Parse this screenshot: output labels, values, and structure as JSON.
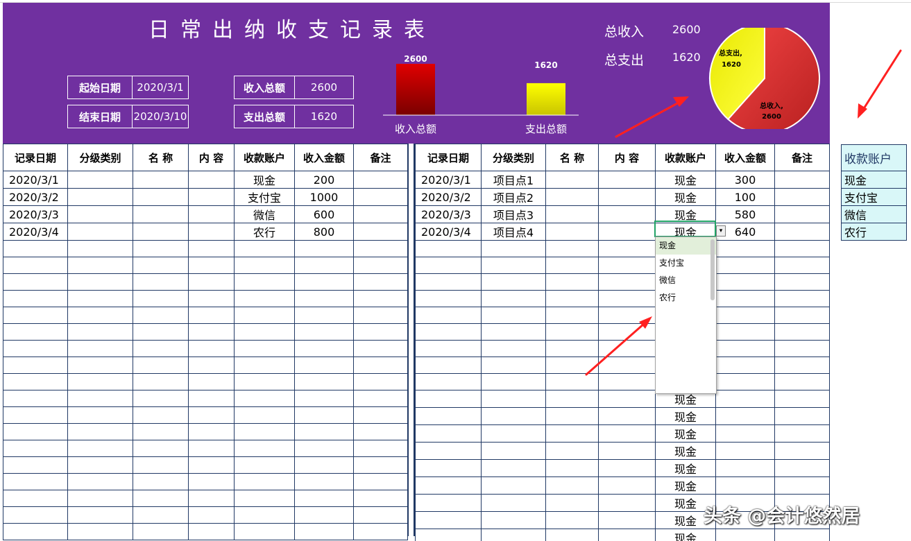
{
  "title": "日常出纳收支记录表",
  "kpis": [
    {
      "label": "起始日期",
      "value": "2020/3/1"
    },
    {
      "label": "结束日期",
      "value": "2020/3/10"
    },
    {
      "label": "收入总额",
      "value": "2600"
    },
    {
      "label": "支出总额",
      "value": "1620"
    }
  ],
  "summary": {
    "income_label": "总收入",
    "income_value": "2600",
    "expense_label": "总支出",
    "expense_value": "1620"
  },
  "colors": {
    "purple": "#7030a0",
    "income_bar": "#c00000",
    "expense_bar": "#f2e600",
    "pie_income": "#e03a3a",
    "pie_expense": "#e6e600",
    "account_fill": "#d9f7f8",
    "active_cell": "#21a366"
  },
  "chart_data": [
    {
      "type": "bar",
      "categories": [
        "收入总额",
        "支出总额"
      ],
      "values": [
        2600,
        1620
      ],
      "title": ""
    },
    {
      "type": "pie",
      "labels": [
        "总收入",
        "总支出"
      ],
      "values": [
        2600,
        1620
      ],
      "data_labels": [
        "总收入,",
        "总支出,"
      ],
      "title": ""
    }
  ],
  "income_table": {
    "headers": [
      "记录日期",
      "分级类别",
      "名 称",
      "内 容",
      "收款账户",
      "收入金额",
      "备注"
    ],
    "rows": [
      [
        "2020/3/1",
        "",
        "",
        "",
        "现金",
        "200",
        ""
      ],
      [
        "2020/3/2",
        "",
        "",
        "",
        "支付宝",
        "1000",
        ""
      ],
      [
        "2020/3/3",
        "",
        "",
        "",
        "微信",
        "600",
        ""
      ],
      [
        "2020/3/4",
        "",
        "",
        "",
        "农行",
        "800",
        ""
      ]
    ]
  },
  "expense_table": {
    "headers": [
      "记录日期",
      "分级类别",
      "名 称",
      "内 容",
      "收款账户",
      "收入金额",
      "备注"
    ],
    "rows": [
      [
        "2020/3/1",
        "项目点1",
        "",
        "",
        "现金",
        "300",
        ""
      ],
      [
        "2020/3/2",
        "项目点2",
        "",
        "",
        "现金",
        "100",
        ""
      ],
      [
        "2020/3/3",
        "项目点3",
        "",
        "",
        "现金",
        "580",
        ""
      ],
      [
        "2020/3/4",
        "项目点4",
        "",
        "",
        "现金",
        "640",
        ""
      ]
    ],
    "filled_account": "现金"
  },
  "accounts": {
    "header": "收款账户",
    "items": [
      "现金",
      "支付宝",
      "微信",
      "农行"
    ]
  },
  "dropdown": {
    "options": [
      "现金",
      "支付宝",
      "微信",
      "农行"
    ],
    "selected": "现金"
  },
  "watermark": "头条 @会计悠然居"
}
